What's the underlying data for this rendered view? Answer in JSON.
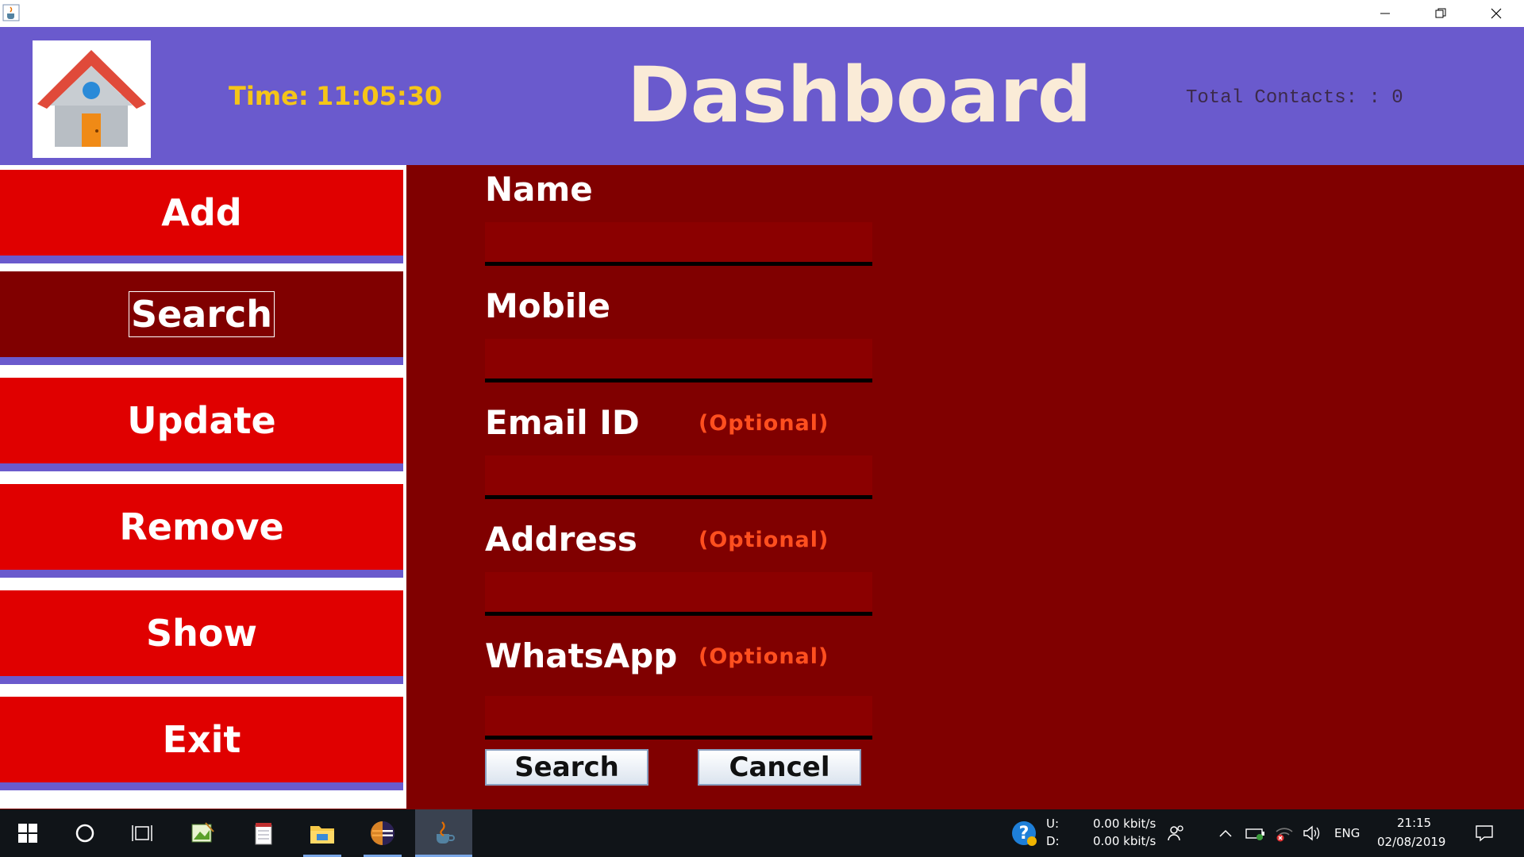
{
  "window": {
    "icon": "java-cup-icon",
    "controls": [
      "minimize-icon",
      "maximize-icon",
      "close-icon"
    ]
  },
  "header": {
    "logo": "house-icon",
    "time_label": "Time:",
    "time_value": "11:05:30",
    "title": "Dashboard",
    "total_contacts": "Total Contacts: : 0"
  },
  "sidebar": {
    "items": [
      {
        "label": "Add",
        "active": false
      },
      {
        "label": "Search",
        "active": true
      },
      {
        "label": "Update",
        "active": false
      },
      {
        "label": "Remove",
        "active": false
      },
      {
        "label": "Show",
        "active": false
      },
      {
        "label": "Exit",
        "active": false
      }
    ]
  },
  "form": {
    "fields": [
      {
        "label": "Name",
        "optional": "",
        "value": ""
      },
      {
        "label": "Mobile",
        "optional": "",
        "value": ""
      },
      {
        "label": "Email ID",
        "optional": "(Optional)",
        "value": ""
      },
      {
        "label": "Address",
        "optional": "(Optional)",
        "value": ""
      },
      {
        "label": "WhatsApp",
        "optional": "(Optional)",
        "value": ""
      }
    ],
    "search_button": "Search",
    "cancel_button": "Cancel"
  },
  "taskbar": {
    "apps": [
      "windows-start-icon",
      "cortana-circle-icon",
      "task-view-icon",
      "image-editor-icon",
      "notepad-icon",
      "file-explorer-icon",
      "eclipse-icon",
      "java-app-icon"
    ],
    "net_up_label": "U:",
    "net_down_label": "D:",
    "net_up": "0.00 kbit/s",
    "net_down": "0.00 kbit/s",
    "language": "ENG",
    "clock_time": "21:15",
    "clock_date": "02/08/2019"
  },
  "colors": {
    "header_bg": "#6a5acd",
    "content_bg": "#800000",
    "nav_bg": "#e00000",
    "nav_active_bg": "#800000",
    "title_text": "#faebd7",
    "time_text": "#f5c518",
    "optional_text": "#ff4f1f"
  }
}
